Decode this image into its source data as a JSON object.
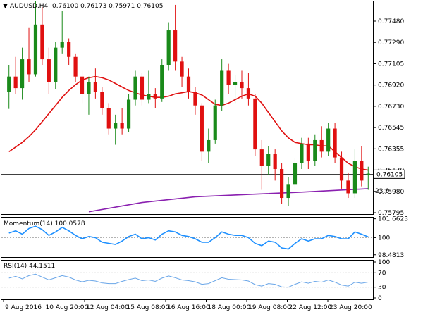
{
  "colors": {
    "bull": "#1a8a1a",
    "bear": "#e01010",
    "ma_red": "#e01010",
    "ma_purple": "#8a20b0",
    "momentum": "#1e90ff",
    "rsi": "#6aa6e8",
    "grid": "#000000",
    "level_grid": "#999999"
  },
  "header": {
    "symbol_tf": "AUDUSD,H4",
    "ohlc": "0.76100 0.76173 0.75971 0.76105",
    "arrow": "▼"
  },
  "price_axis": {
    "ticks": [
      "0.77480",
      "0.77290",
      "0.77105",
      "0.76920",
      "0.76730",
      "0.76545",
      "0.76355",
      "0.76170",
      "0.75980",
      "0.75795"
    ],
    "current_price": "0.76105"
  },
  "fib_label": "23.6",
  "momentum": {
    "label": "Momentum(14) 100.0578",
    "ticks": [
      "101.6623",
      "100",
      "98.4813"
    ]
  },
  "rsi": {
    "label": "RSI(14) 44.1511",
    "ticks": [
      "100",
      "70",
      "30",
      "0"
    ]
  },
  "time_axis": {
    "labels": [
      "9 Aug 2016",
      "10 Aug 20:00",
      "12 Aug 04:00",
      "15 Aug 08:00",
      "16 Aug 16:00",
      "18 Aug 00:00",
      "19 Aug 08:00",
      "22 Aug 12:00",
      "23 Aug 20:00"
    ]
  },
  "chart_data": {
    "type": "candlestick",
    "symbol": "AUDUSD",
    "timeframe": "H4",
    "candles": [
      {
        "o": 0.7682,
        "h": 0.7705,
        "l": 0.7667,
        "c": 0.7695
      },
      {
        "o": 0.7695,
        "h": 0.7712,
        "l": 0.768,
        "c": 0.7685
      },
      {
        "o": 0.7685,
        "h": 0.772,
        "l": 0.7675,
        "c": 0.771
      },
      {
        "o": 0.771,
        "h": 0.7737,
        "l": 0.769,
        "c": 0.7697
      },
      {
        "o": 0.7697,
        "h": 0.776,
        "l": 0.7695,
        "c": 0.774
      },
      {
        "o": 0.774,
        "h": 0.7755,
        "l": 0.7705,
        "c": 0.771
      },
      {
        "o": 0.771,
        "h": 0.772,
        "l": 0.768,
        "c": 0.769
      },
      {
        "o": 0.769,
        "h": 0.7725,
        "l": 0.7684,
        "c": 0.772
      },
      {
        "o": 0.772,
        "h": 0.7752,
        "l": 0.7715,
        "c": 0.7725
      },
      {
        "o": 0.7725,
        "h": 0.7728,
        "l": 0.7705,
        "c": 0.7712
      },
      {
        "o": 0.7712,
        "h": 0.7715,
        "l": 0.769,
        "c": 0.7695
      },
      {
        "o": 0.7695,
        "h": 0.77,
        "l": 0.7672,
        "c": 0.768
      },
      {
        "o": 0.768,
        "h": 0.7695,
        "l": 0.7662,
        "c": 0.769
      },
      {
        "o": 0.769,
        "h": 0.7702,
        "l": 0.7676,
        "c": 0.7682
      },
      {
        "o": 0.7682,
        "h": 0.7686,
        "l": 0.7662,
        "c": 0.7668
      },
      {
        "o": 0.7668,
        "h": 0.7672,
        "l": 0.7645,
        "c": 0.765
      },
      {
        "o": 0.765,
        "h": 0.7662,
        "l": 0.7636,
        "c": 0.7655
      },
      {
        "o": 0.7655,
        "h": 0.7668,
        "l": 0.7645,
        "c": 0.765
      },
      {
        "o": 0.765,
        "h": 0.768,
        "l": 0.7647,
        "c": 0.7675
      },
      {
        "o": 0.7675,
        "h": 0.77,
        "l": 0.767,
        "c": 0.7695
      },
      {
        "o": 0.7695,
        "h": 0.7698,
        "l": 0.767,
        "c": 0.7675
      },
      {
        "o": 0.7675,
        "h": 0.77,
        "l": 0.7672,
        "c": 0.768
      },
      {
        "o": 0.768,
        "h": 0.7685,
        "l": 0.7668,
        "c": 0.7676
      },
      {
        "o": 0.7676,
        "h": 0.771,
        "l": 0.7673,
        "c": 0.7705
      },
      {
        "o": 0.7705,
        "h": 0.7742,
        "l": 0.77,
        "c": 0.7735
      },
      {
        "o": 0.7735,
        "h": 0.7757,
        "l": 0.77,
        "c": 0.7708
      },
      {
        "o": 0.7708,
        "h": 0.7712,
        "l": 0.7686,
        "c": 0.7695
      },
      {
        "o": 0.7695,
        "h": 0.7702,
        "l": 0.7676,
        "c": 0.7682
      },
      {
        "o": 0.7682,
        "h": 0.7686,
        "l": 0.7662,
        "c": 0.767
      },
      {
        "o": 0.767,
        "h": 0.7672,
        "l": 0.7622,
        "c": 0.763
      },
      {
        "o": 0.763,
        "h": 0.765,
        "l": 0.762,
        "c": 0.764
      },
      {
        "o": 0.764,
        "h": 0.7675,
        "l": 0.7637,
        "c": 0.767
      },
      {
        "o": 0.767,
        "h": 0.771,
        "l": 0.7665,
        "c": 0.77
      },
      {
        "o": 0.77,
        "h": 0.7706,
        "l": 0.768,
        "c": 0.7688
      },
      {
        "o": 0.7688,
        "h": 0.7696,
        "l": 0.7672,
        "c": 0.769
      },
      {
        "o": 0.769,
        "h": 0.77,
        "l": 0.7676,
        "c": 0.7685
      },
      {
        "o": 0.7685,
        "h": 0.7698,
        "l": 0.767,
        "c": 0.7676
      },
      {
        "o": 0.7676,
        "h": 0.768,
        "l": 0.7626,
        "c": 0.7632
      },
      {
        "o": 0.7632,
        "h": 0.764,
        "l": 0.7597,
        "c": 0.7618
      },
      {
        "o": 0.7618,
        "h": 0.7635,
        "l": 0.761,
        "c": 0.7628
      },
      {
        "o": 0.7628,
        "h": 0.7632,
        "l": 0.7605,
        "c": 0.7615
      },
      {
        "o": 0.7615,
        "h": 0.762,
        "l": 0.7585,
        "c": 0.759
      },
      {
        "o": 0.759,
        "h": 0.7608,
        "l": 0.7583,
        "c": 0.7602
      },
      {
        "o": 0.7602,
        "h": 0.7625,
        "l": 0.7598,
        "c": 0.762
      },
      {
        "o": 0.762,
        "h": 0.7642,
        "l": 0.7615,
        "c": 0.7637
      },
      {
        "o": 0.7637,
        "h": 0.7642,
        "l": 0.7615,
        "c": 0.7622
      },
      {
        "o": 0.7622,
        "h": 0.7645,
        "l": 0.7618,
        "c": 0.764
      },
      {
        "o": 0.764,
        "h": 0.7652,
        "l": 0.7625,
        "c": 0.763
      },
      {
        "o": 0.763,
        "h": 0.7655,
        "l": 0.7626,
        "c": 0.765
      },
      {
        "o": 0.765,
        "h": 0.7655,
        "l": 0.762,
        "c": 0.7625
      },
      {
        "o": 0.7625,
        "h": 0.763,
        "l": 0.7598,
        "c": 0.7605
      },
      {
        "o": 0.7605,
        "h": 0.7612,
        "l": 0.759,
        "c": 0.7594
      },
      {
        "o": 0.7594,
        "h": 0.7632,
        "l": 0.759,
        "c": 0.7622
      },
      {
        "o": 0.7622,
        "h": 0.7635,
        "l": 0.76,
        "c": 0.7605
      },
      {
        "o": 0.761,
        "h": 0.7617,
        "l": 0.7597,
        "c": 0.7611
      }
    ],
    "ma_red_values": [
      0.763,
      0.7634,
      0.7638,
      0.7643,
      0.7649,
      0.7656,
      0.7663,
      0.767,
      0.7677,
      0.7683,
      0.7688,
      0.7692,
      0.7694,
      0.7695,
      0.7694,
      0.7692,
      0.7689,
      0.7686,
      0.7683,
      0.7681,
      0.7679,
      0.7678,
      0.7677,
      0.7677,
      0.7678,
      0.768,
      0.7681,
      0.7682,
      0.7681,
      0.7679,
      0.7675,
      0.7671,
      0.767,
      0.7672,
      0.7675,
      0.7678,
      0.768,
      0.7678,
      0.7672,
      0.7664,
      0.7656,
      0.7648,
      0.7642,
      0.7638,
      0.7637,
      0.7636,
      0.7636,
      0.7635,
      0.7635,
      0.763,
      0.7625,
      0.762,
      0.7617,
      0.7615,
      0.7614
    ],
    "ma_purple_points": [
      [
        12,
        0.7578
      ],
      [
        20,
        0.7586
      ],
      [
        28,
        0.7591
      ],
      [
        36,
        0.7593
      ],
      [
        44,
        0.7595
      ],
      [
        54,
        0.7598
      ]
    ],
    "fib_level": 0.75995,
    "current_price": 0.76105,
    "price_range": [
      0.7576,
      0.776
    ],
    "momentum_values": [
      100.4,
      100.6,
      100.3,
      100.8,
      101.0,
      100.7,
      100.2,
      100.5,
      100.9,
      100.6,
      100.2,
      99.9,
      100.1,
      100.0,
      99.6,
      99.5,
      99.4,
      99.7,
      100.1,
      100.3,
      99.9,
      100.0,
      99.8,
      100.3,
      100.6,
      100.5,
      100.2,
      100.1,
      99.9,
      99.6,
      99.6,
      100.0,
      100.5,
      100.3,
      100.2,
      100.2,
      100.0,
      99.5,
      99.3,
      99.7,
      99.6,
      99.1,
      99.0,
      99.5,
      99.9,
      99.7,
      99.9,
      99.9,
      100.2,
      100.1,
      99.9,
      99.9,
      100.5,
      100.3,
      100.06
    ],
    "momentum_range": [
      98.3,
      101.75
    ],
    "rsi_values": [
      55,
      60,
      53,
      62,
      66,
      58,
      50,
      56,
      62,
      58,
      50,
      45,
      49,
      47,
      42,
      40,
      40,
      46,
      51,
      55,
      48,
      50,
      46,
      55,
      61,
      56,
      50,
      48,
      45,
      38,
      40,
      48,
      56,
      52,
      51,
      50,
      47,
      37,
      33,
      40,
      38,
      31,
      30,
      38,
      45,
      41,
      46,
      44,
      50,
      44,
      36,
      33,
      44,
      41,
      44.15
    ],
    "rsi_levels": [
      70,
      30
    ],
    "rsi_range": [
      0,
      100
    ]
  }
}
